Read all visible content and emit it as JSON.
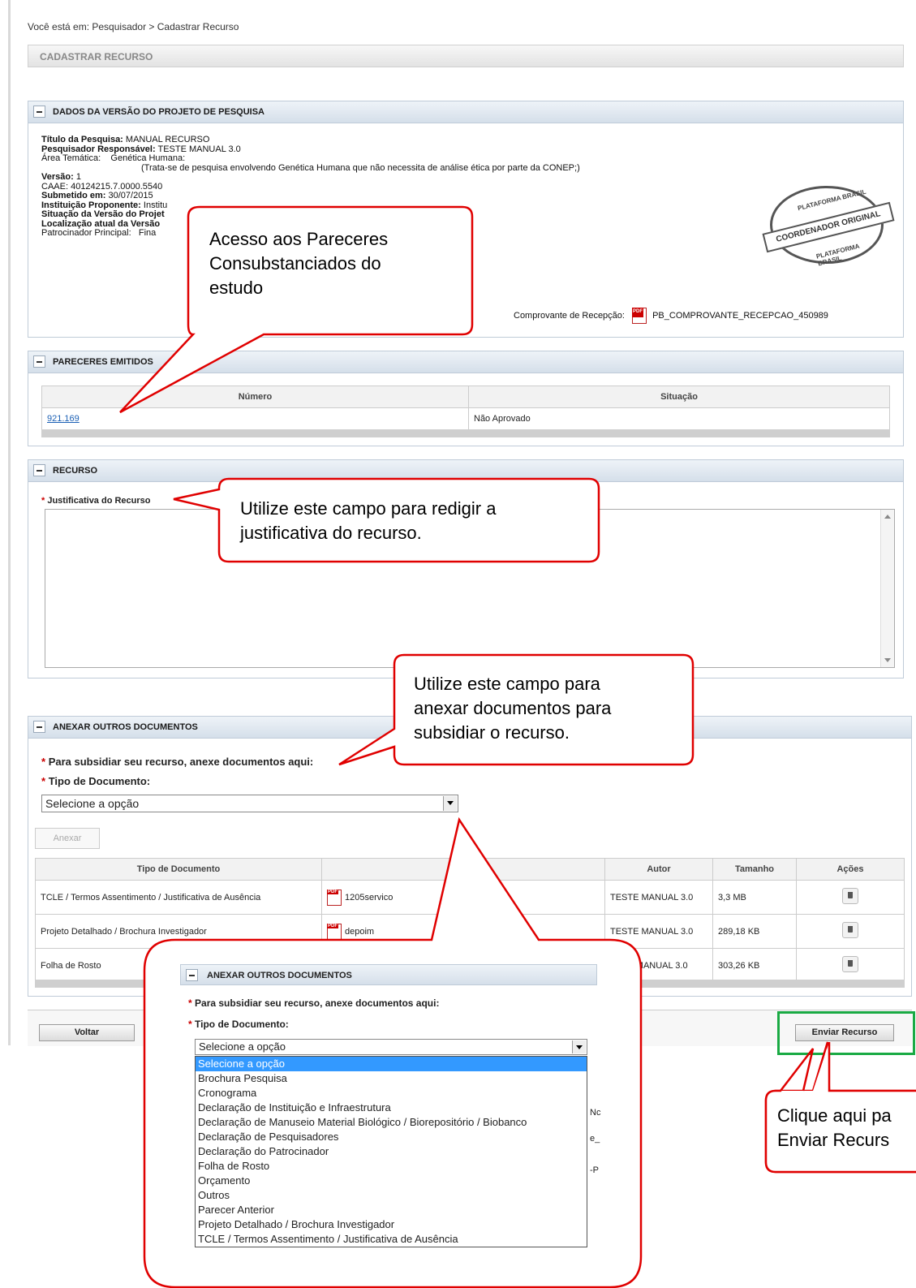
{
  "breadcrumb": "Você está em: Pesquisador > Cadastrar Recurso",
  "page_title": "CADASTRAR RECURSO",
  "dados": {
    "title": "DADOS DA VERSÃO DO PROJETO DE PESQUISA",
    "titulo_label": "Título da Pesquisa:",
    "titulo_value": "MANUAL RECURSO",
    "pesquisador_label": "Pesquisador Responsável:",
    "pesquisador_value": "TESTE MANUAL 3.0",
    "area_label": "Área Temática:",
    "area_value": "Genética Humana:",
    "area_note": "(Trata-se de pesquisa envolvendo Genética Humana que não necessita de análise ética por parte da CONEP;)",
    "versao_label": "Versão:",
    "versao_value": "1",
    "caae_label": "CAAE:",
    "caae_value": "40124215.7.0000.5540",
    "submetido_label": "Submetido em:",
    "submetido_value": "30/07/2015",
    "instituicao_label": "Instituição Proponente:",
    "instituicao_value": "Institu",
    "situacao_label": "Situação da Versão do Projet",
    "localizacao_label": "Localização atual da Versão",
    "patrocinador_label": "Patrocinador Principal:",
    "patrocinador_value": "Fina",
    "comprovante_label": "Comprovante de Recepção:",
    "comprovante_file": "PB_COMPROVANTE_RECEPCAO_450989",
    "stamp_top": "PLATAFORMA BRASIL",
    "stamp_band": "COORDENADOR ORIGINAL",
    "stamp_bottom": "PLATAFORMA BRASIL"
  },
  "pareceres": {
    "title": "PARECERES EMITIDOS",
    "col_numero": "Número",
    "col_situacao": "Situação",
    "rows": [
      {
        "numero": "921.169",
        "situacao": "Não Aprovado"
      }
    ]
  },
  "recurso": {
    "title": "RECURSO",
    "justificativa_label": "Justificativa do Recurso",
    "justificativa_value": ""
  },
  "anexar": {
    "title": "ANEXAR OUTROS DOCUMENTOS",
    "subsidiar_label": "Para subsidiar seu recurso, anexe documentos aqui:",
    "tipo_label": "Tipo de Documento:",
    "tipo_selected": "Selecione a opção",
    "anexar_button": "Anexar",
    "col_tipo": "Tipo de Documento",
    "col_arquivo": "",
    "col_autor": "Autor",
    "col_tamanho": "Tamanho",
    "col_acoes": "Ações",
    "rows": [
      {
        "tipo": "TCLE / Termos Assentimento / Justificativa de Ausência",
        "arquivo": "1205servico",
        "autor": "TESTE MANUAL 3.0",
        "tamanho": "3,3 MB"
      },
      {
        "tipo": "Projeto Detalhado / Brochura Investigador",
        "arquivo": "depoim",
        "autor": "TESTE MANUAL 3.0",
        "tamanho": "289,18 KB"
      },
      {
        "tipo": "Folha de Rosto",
        "arquivo": "",
        "autor": "ESTE MANUAL 3.0",
        "tamanho": "303,26 KB"
      }
    ]
  },
  "buttons": {
    "voltar": "Voltar",
    "enviar": "Enviar Recurso"
  },
  "zoom": {
    "title": "ANEXAR OUTROS DOCUMENTOS",
    "subsidiar_label": "Para subsidiar seu recurso, anexe documentos aqui:",
    "tipo_label": "Tipo de Documento:",
    "tipo_selected": "Selecione a opção",
    "options": [
      "Selecione a opção",
      "Brochura Pesquisa",
      "Cronograma",
      "Declaração de Instituição e Infraestrutura",
      "Declaração de Manuseio Material Biológico / Biorepositório / Biobanco",
      "Declaração de Pesquisadores",
      "Declaração do Patrocinador",
      "Folha de Rosto",
      "Orçamento",
      "Outros",
      "Parecer Anterior",
      "Projeto Detalhado / Brochura Investigador",
      "TCLE / Termos Assentimento / Justificativa de Ausência"
    ],
    "frag_no": "Nc",
    "frag_e": "e_",
    "frag_p": "-P"
  },
  "callouts": {
    "pareceres_1": "Acesso aos Pareceres",
    "pareceres_2": "Consubstanciados do",
    "pareceres_3": "estudo",
    "justificativa_1": "Utilize este campo para redigir a",
    "justificativa_2": "justificativa do recurso.",
    "anexar_1": "Utilize este campo para",
    "anexar_2": "anexar documentos para",
    "anexar_3": "subsidiar o recurso.",
    "enviar_1": "Clique aqui pa",
    "enviar_2": "Enviar Recurs"
  },
  "colors": {
    "callout_border": "#e00000",
    "highlight_green": "#1aaa44",
    "link": "#1a5fb4"
  }
}
